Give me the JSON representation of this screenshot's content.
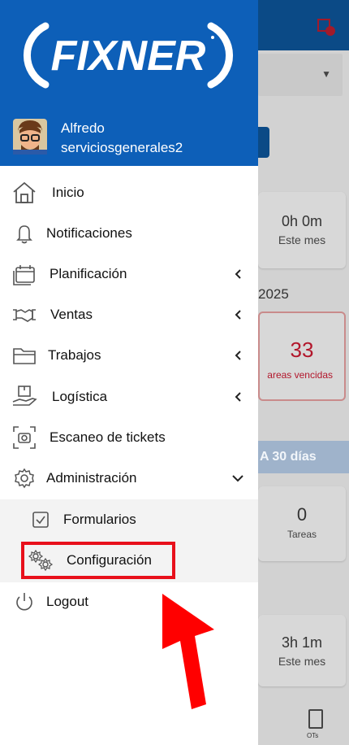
{
  "brand": {
    "logo_text": "FIXNER"
  },
  "user": {
    "name": "Alfredo",
    "email": "serviciosgenerales2"
  },
  "menu": {
    "inicio": "Inicio",
    "notificaciones": "Notificaciones",
    "planificacion": "Planificación",
    "ventas": "Ventas",
    "trabajos": "Trabajos",
    "logistica": "Logística",
    "escaneo": "Escaneo de tickets",
    "administracion": "Administración",
    "formularios": "Formularios",
    "configuracion": "Configuración",
    "logout": "Logout"
  },
  "background": {
    "card1_value": "0h 0m",
    "card1_sub": "Este mes",
    "year": "2025",
    "overdue_value": "33",
    "overdue_label": "areas vencidas",
    "band_label": "A 30 días",
    "card2_value": "0",
    "card2_sub": "Tareas",
    "card3_value": "3h 1m",
    "card3_sub": "Este mes",
    "bottom_nav_label": "OTs"
  },
  "colors": {
    "header_blue": "#0d5fb8",
    "highlight_red": "#e8101b",
    "overdue_red": "#b2162b"
  },
  "icons": {
    "home": "home-icon",
    "bell": "bell-icon",
    "calendar": "calendar-icon",
    "handshake": "handshake-icon",
    "folder": "folder-icon",
    "box_hand": "box-hand-icon",
    "scan": "scan-camera-icon",
    "gear": "gear-icon",
    "checkbox": "checkbox-icon",
    "gears": "gears-icon",
    "power": "power-icon"
  }
}
